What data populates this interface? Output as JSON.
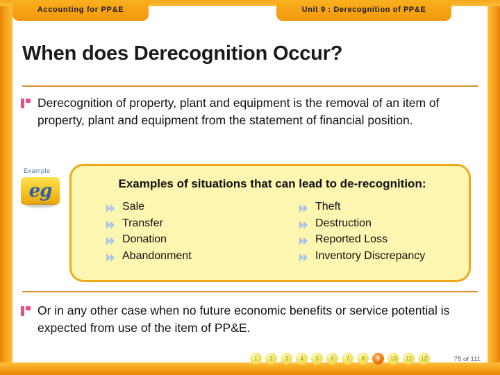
{
  "tabs": {
    "left_label": "Accounting for PP&E",
    "center_label": "Unit 9 : Derecognition of PP&E"
  },
  "slide": {
    "title": "When does Derecognition Occur?",
    "bullet_1": "Derecognition of property, plant and equipment is the removal of an item of property, plant and equipment from the statement of financial position.",
    "bullet_2": "Or in any other case when no future economic benefits or service potential is expected from use of the item of PP&E."
  },
  "example": {
    "label": "Example",
    "icon_text": "eg"
  },
  "callout": {
    "heading": "Examples of situations that can lead to de-recognition:",
    "left_items": [
      "Sale",
      "Transfer",
      "Donation",
      "Abandonment"
    ],
    "right_items": [
      "Theft",
      "Destruction",
      "Reported Loss",
      "Inventory Discrepancy"
    ]
  },
  "footer": {
    "pages": [
      "1",
      "2",
      "3",
      "4",
      "5",
      "6",
      "7",
      "8",
      "9",
      "10",
      "11",
      "12"
    ],
    "active_page": "9",
    "page_count": "75 of 111"
  },
  "colors": {
    "frame": "#f5a418",
    "bullet": "#e84c8a",
    "callout_bg": "#fdf6b0",
    "callout_border": "#f0a81a",
    "rule": "#d98f2a",
    "active_dot": "#f07a10"
  }
}
